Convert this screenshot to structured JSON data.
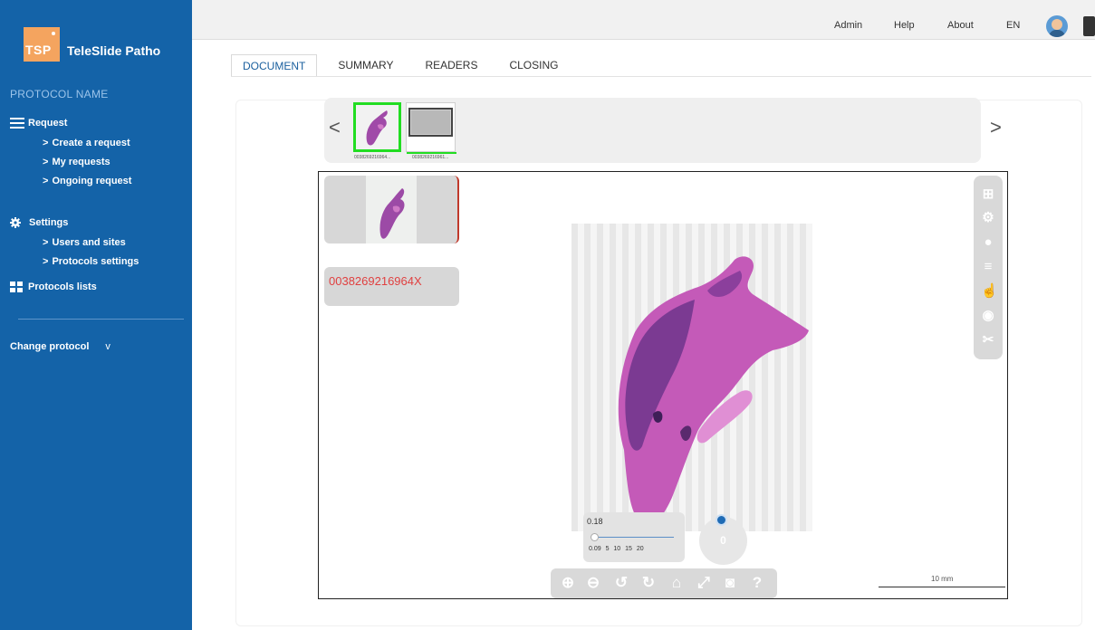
{
  "brand": {
    "logo_text": "TSP",
    "name": "TeleSlide Patho"
  },
  "sidebar": {
    "protocol_name": "PROTOCOL NAME",
    "request": {
      "label": "Request",
      "items": [
        "Create a request",
        "My requests",
        "Ongoing request"
      ]
    },
    "settings": {
      "label": "Settings",
      "items": [
        "Users and sites",
        "Protocols settings"
      ]
    },
    "protocols_lists": "Protocols lists",
    "change_protocol": "Change protocol",
    "change_protocol_caret": "v",
    "sub_chevron": ">"
  },
  "topbar": {
    "links": [
      "Admin",
      "Help",
      "About",
      "EN"
    ]
  },
  "tabs": [
    "DOCUMENT",
    "SUMMARY",
    "READERS",
    "CLOSING"
  ],
  "carousel": {
    "prev": "<",
    "next": ">",
    "thumbnails": [
      {
        "label": "0038269216964..."
      },
      {
        "label": "0038269216961..."
      }
    ]
  },
  "viewer": {
    "barcode": "0038269216964X",
    "zoom": {
      "current": "0.18",
      "ticks": "0.09 5 10 15 20",
      "slider_level": 0.0
    },
    "rotation": "0",
    "scale_label": "10 mm",
    "side_toolbar": [
      "grid-icon",
      "settings-cogs-icon",
      "comment-icon",
      "sliders-icon",
      "pointer-hand-icon",
      "eye-icon",
      "tools-icon"
    ],
    "bottom_toolbar": [
      "zoom-in-icon",
      "zoom-out-icon",
      "rotate-left-icon",
      "rotate-right-icon",
      "home-icon",
      "fullscreen-icon",
      "camera-icon",
      "help-icon"
    ]
  },
  "colors": {
    "sidebar": "#1463a8",
    "accent_orange": "#f4a45f",
    "selected_green": "#22dd22",
    "barcode_red": "#e04040"
  }
}
